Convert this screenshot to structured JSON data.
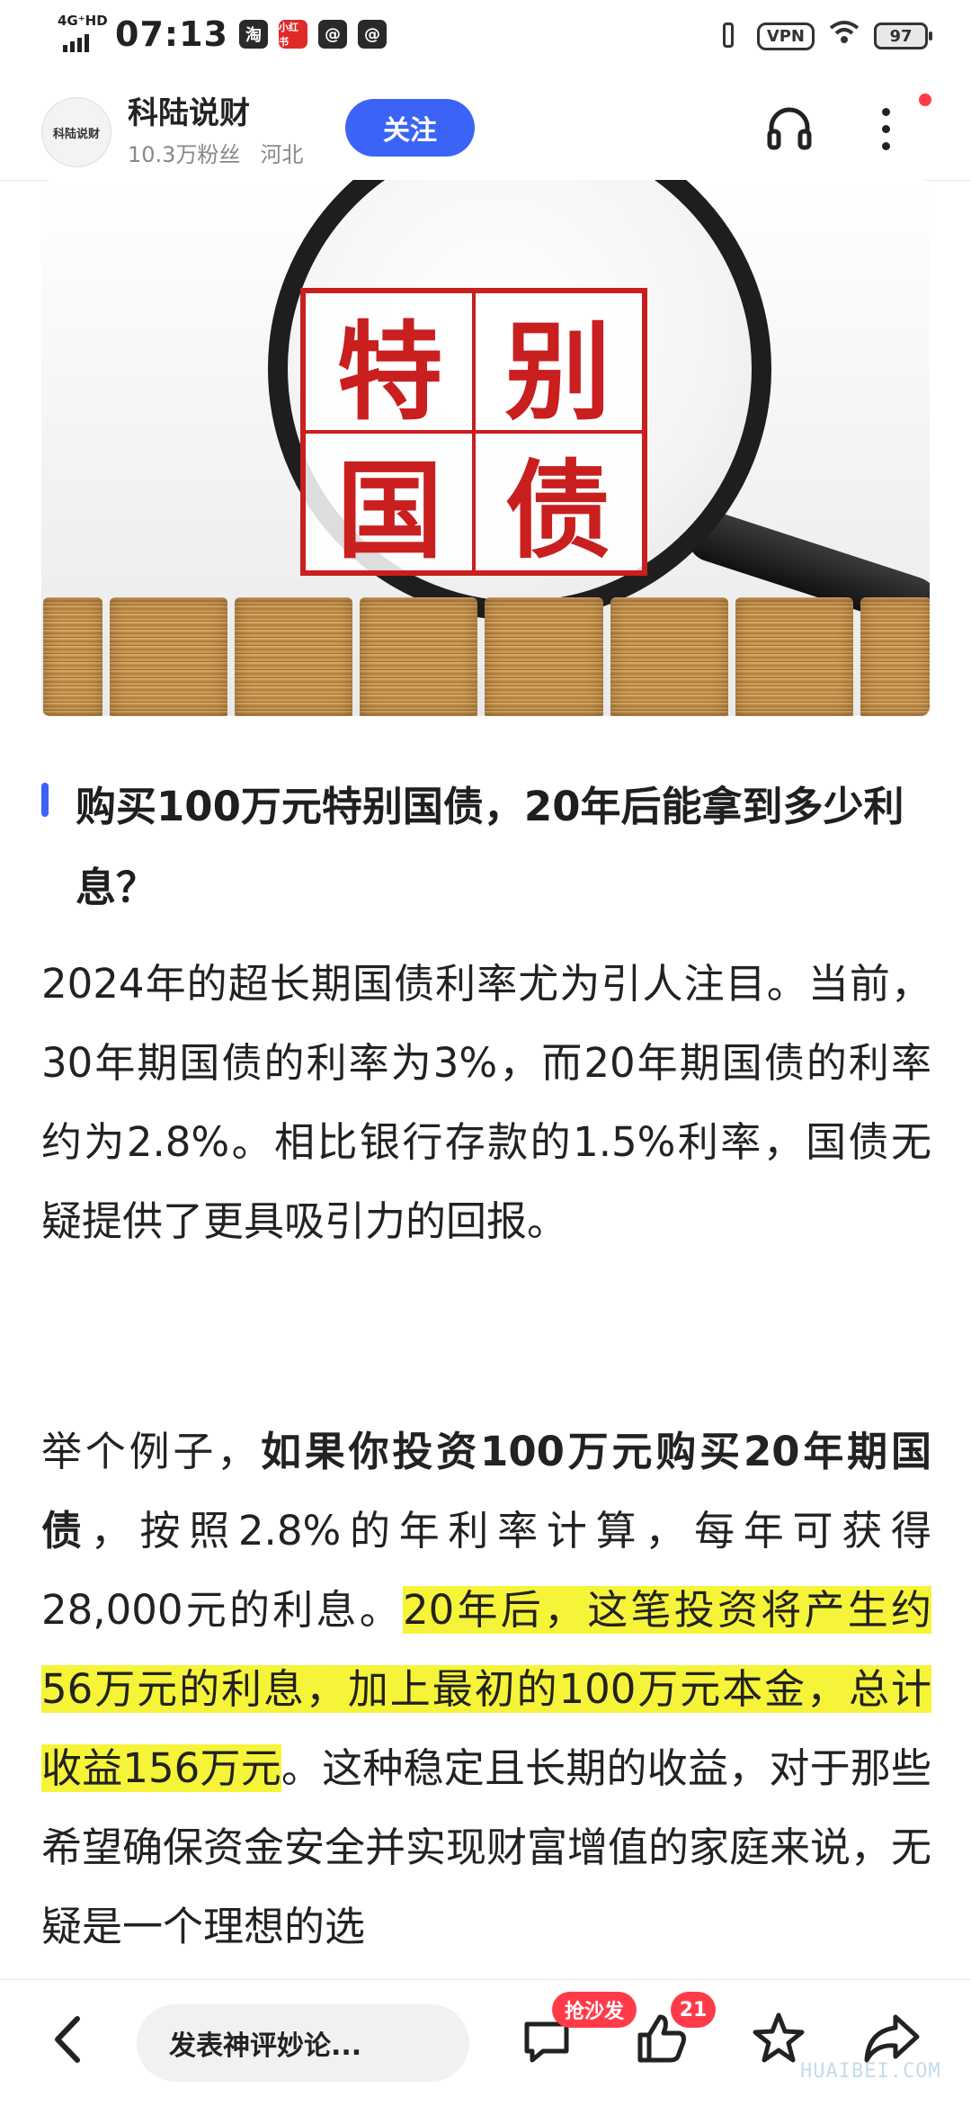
{
  "status_bar": {
    "network": "4G⁺HD",
    "time": "07:13",
    "app_icons": [
      "淘",
      "小红书",
      "@",
      "@"
    ],
    "vpn": "VPN",
    "battery": "97"
  },
  "header": {
    "avatar_text": "科陆说财",
    "author_name": "科陆说财",
    "followers": "10.3万粉丝",
    "location": "河北",
    "follow_label": "关注"
  },
  "hero": {
    "chars": [
      "特",
      "别",
      "国",
      "债"
    ]
  },
  "article": {
    "section_title": "购买100万元特别国债，20年后能拿到多少利息？",
    "para1": "2024年的超长期国债利率尤为引人注目。当前，30年期国债的利率为3%，而20年期国债的利率约为2.8%。相比银行存款的1.5%利率，国债无疑提供了更具吸引力的回报。",
    "para2": {
      "intro": "举个例子，",
      "bold": "如果你投资100万元购买20年期国债",
      "mid": "，按照2.8%的年利率计算，每年可获得28,000元的利息。",
      "highlight": "20年后，这笔投资将产生约56万元的利息，加上最初的100万元本金，总计收益156万元",
      "tail": "。这种稳定且长期的收益，对于那些希望确保资金安全并实现财富增值的家庭来说，无疑是一个理想的选"
    }
  },
  "bottom_bar": {
    "comment_placeholder": "发表神评妙论...",
    "sofa_badge": "抢沙发",
    "like_count": "21",
    "watermark": "HUAIBEI.COM"
  },
  "colors": {
    "accent": "#3b63f6",
    "badge": "#ff3b4a",
    "highlight": "#f6f438",
    "bond_red": "#c91f1f"
  }
}
